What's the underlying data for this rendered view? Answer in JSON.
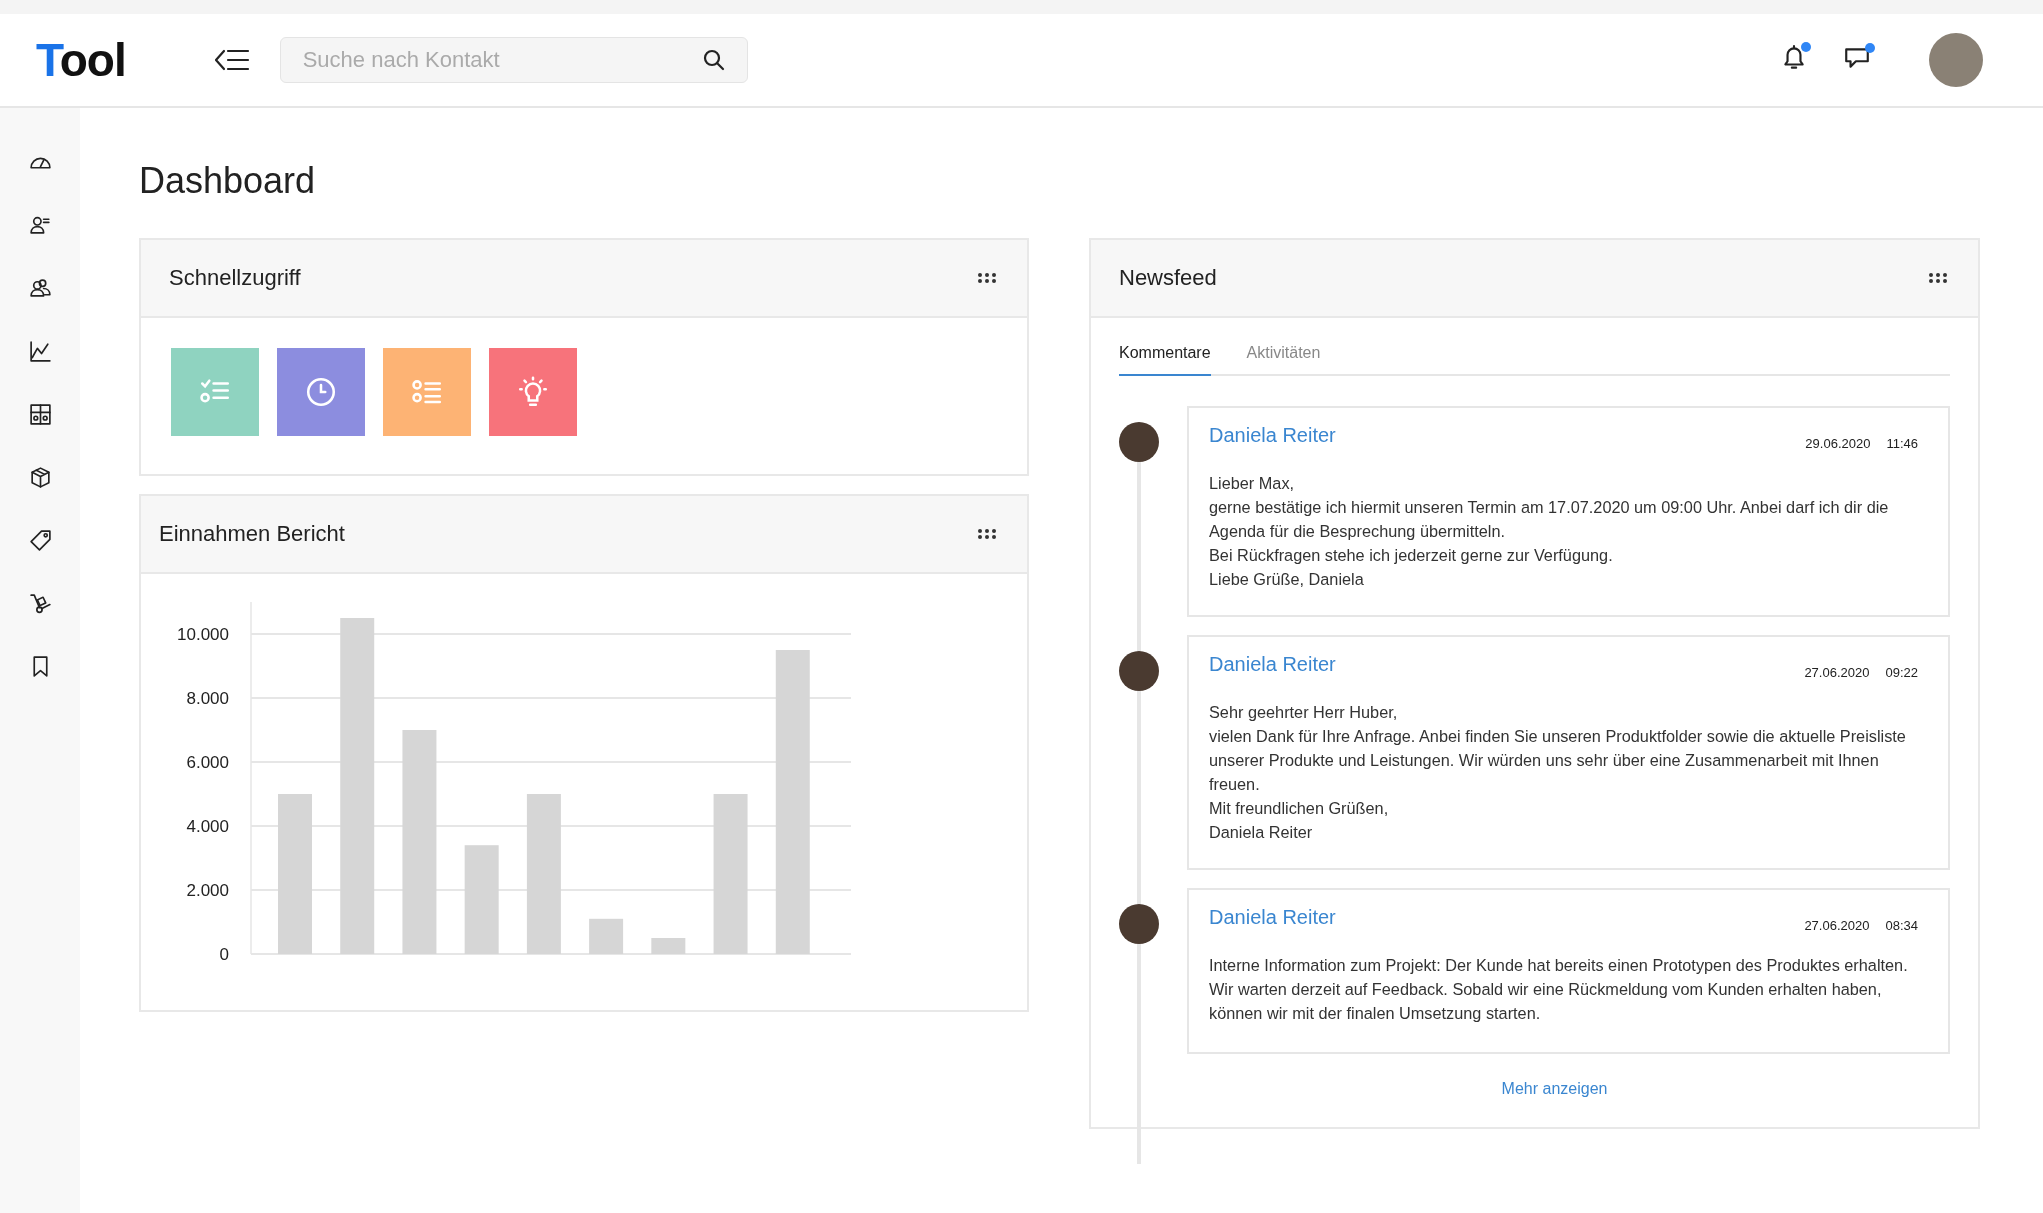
{
  "header": {
    "logo": "Tool",
    "search": {
      "placeholder": "Suche nach Kontakt"
    },
    "notifications": {
      "unread": true
    },
    "messages": {
      "unread": true
    }
  },
  "sidebar": {
    "items": [
      {
        "kind": "gauge"
      },
      {
        "kind": "contact"
      },
      {
        "kind": "people"
      },
      {
        "kind": "chart"
      },
      {
        "kind": "grid"
      },
      {
        "kind": "box"
      },
      {
        "kind": "tag"
      },
      {
        "kind": "trolley"
      },
      {
        "kind": "bookmark"
      }
    ]
  },
  "page_title": "Dashboard",
  "quick_access": {
    "title": "Schnellzugriff",
    "tiles": [
      {
        "kind": "checklist",
        "color": "#8fd3c0"
      },
      {
        "kind": "clock",
        "color": "#8c8ddf"
      },
      {
        "kind": "list",
        "color": "#fdb374"
      },
      {
        "kind": "bulb",
        "color": "#f7737b"
      }
    ]
  },
  "revenue_report": {
    "title": "Einnahmen Bericht",
    "chart_data": {
      "type": "bar",
      "values": [
        5000,
        10500,
        7000,
        3400,
        5000,
        1100,
        500,
        5000,
        9500
      ],
      "ylim": [
        0,
        11000
      ],
      "grid": true,
      "yticks": [
        {
          "value": 0,
          "label": "0"
        },
        {
          "value": 2000,
          "label": "2.000"
        },
        {
          "value": 4000,
          "label": "4.000"
        },
        {
          "value": 6000,
          "label": "6.000"
        },
        {
          "value": 8000,
          "label": "8.000"
        },
        {
          "value": 10000,
          "label": "10.000"
        }
      ]
    }
  },
  "newsfeed": {
    "title": "Newsfeed",
    "tabs": [
      {
        "label": "Kommentare",
        "selected": true
      },
      {
        "label": "Aktivitäten",
        "selected": false
      }
    ],
    "comments": [
      {
        "author": "Daniela Reiter",
        "date": "29.06.2020",
        "time": "11:46",
        "lines": [
          "Lieber Max,",
          "gerne bestätige ich hiermit unseren Termin am 17.07.2020 um 09:00 Uhr. Anbei darf ich dir die Agenda für die Besprechung übermitteln.",
          "Bei Rückfragen stehe ich jederzeit gerne zur Verfügung.",
          "Liebe Grüße, Daniela"
        ]
      },
      {
        "author": "Daniela Reiter",
        "date": "27.06.2020",
        "time": "09:22",
        "lines": [
          "Sehr geehrter Herr Huber,",
          "vielen Dank für Ihre Anfrage. Anbei finden Sie unseren Produktfolder sowie die aktuelle Preisliste unserer Produkte und Leistungen. Wir würden uns sehr über eine Zusammenarbeit mit Ihnen freuen.",
          "Mit freundlichen Grüßen,",
          "Daniela Reiter"
        ]
      },
      {
        "author": "Daniela Reiter",
        "date": "27.06.2020",
        "time": "08:34",
        "lines": [
          "Interne Information zum Projekt: Der Kunde hat bereits einen Prototypen des Produktes erhalten. Wir warten derzeit auf Feedback. Sobald wir eine Rückmeldung vom Kunden erhalten haben, können wir mit der finalen Umsetzung starten."
        ]
      }
    ],
    "more_link": "Mehr anzeigen"
  }
}
